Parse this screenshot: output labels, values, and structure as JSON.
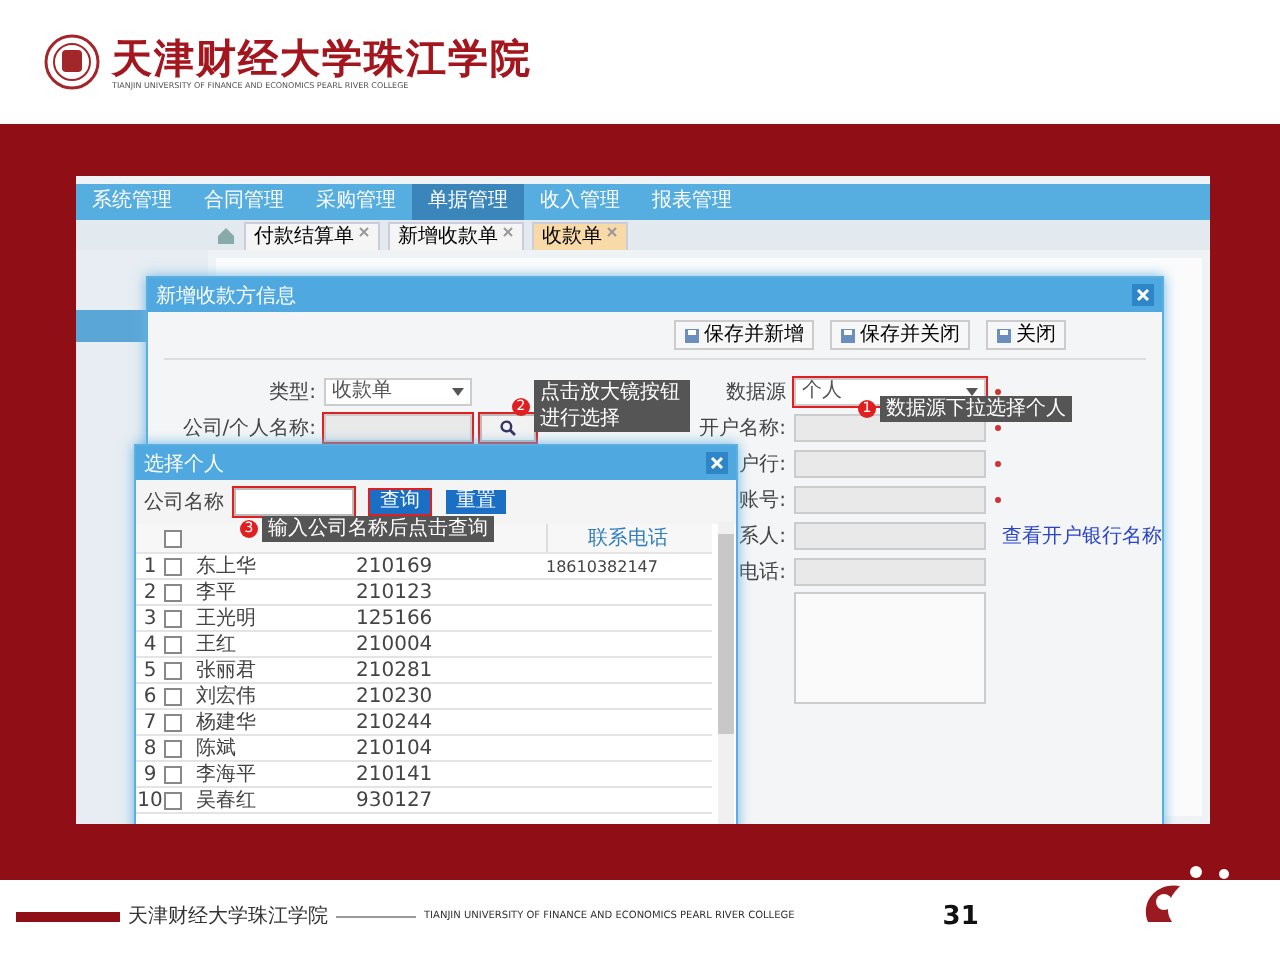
{
  "header": {
    "school_name": "天津财经大学珠江学院",
    "school_name_en": "TIANJIN UNIVERSITY OF FINANCE AND ECONOMICS PEARL RIVER COLLEGE"
  },
  "app": {
    "nav": [
      {
        "label": "系统管理",
        "selected": false
      },
      {
        "label": "合同管理",
        "selected": false
      },
      {
        "label": "采购管理",
        "selected": false
      },
      {
        "label": "单据管理",
        "selected": true
      },
      {
        "label": "收入管理",
        "selected": false
      },
      {
        "label": "报表管理",
        "selected": false
      }
    ],
    "tabs": [
      {
        "label": "付款结算单",
        "selected": false
      },
      {
        "label": "新增收款单",
        "selected": false
      },
      {
        "label": "收款单",
        "selected": true
      }
    ]
  },
  "main_dialog": {
    "title": "新增收款方信息",
    "buttons": [
      "保存并新增",
      "保存并关闭",
      "关闭"
    ],
    "left_fields": [
      {
        "label": "类型:",
        "kind": "select",
        "value": "收款单",
        "highlighted": false
      },
      {
        "label": "公司/个人名称:",
        "kind": "lookup",
        "highlighted": true
      }
    ],
    "right_fields": [
      {
        "label": "数据源",
        "kind": "select",
        "value": "个人",
        "highlighted": true,
        "required": true
      },
      {
        "label": "开户名称:",
        "kind": "text",
        "highlighted": false,
        "required": true
      },
      {
        "label": "户行:",
        "kind": "text",
        "highlighted": false,
        "required": true
      },
      {
        "label": "账号:",
        "kind": "text",
        "highlighted": false,
        "required": true
      },
      {
        "label": "系人:",
        "kind": "text",
        "highlighted": false,
        "required": false,
        "link": "查看开户银行名称"
      },
      {
        "label": "电话:",
        "kind": "text",
        "highlighted": false,
        "required": false
      },
      {
        "kind": "textarea",
        "highlighted": false,
        "required": false
      }
    ]
  },
  "select_dialog": {
    "title": "选择个人",
    "search_label": "公司名称",
    "search_highlighted": true,
    "buttons": [
      {
        "label": "查询",
        "highlighted": true
      },
      {
        "label": "重置",
        "highlighted": false
      }
    ],
    "phone_header": "联系电话",
    "all_checked": false,
    "rows": [
      {
        "index": "1",
        "checked": false,
        "name": "东上华",
        "code": "210169",
        "phone": "18610382147"
      },
      {
        "index": "2",
        "checked": false,
        "name": "李平",
        "code": "210123"
      },
      {
        "index": "3",
        "checked": false,
        "name": "王光明",
        "code": "125166"
      },
      {
        "index": "4",
        "checked": false,
        "name": "王红",
        "code": "210004"
      },
      {
        "index": "5",
        "checked": false,
        "name": "张丽君",
        "code": "210281"
      },
      {
        "index": "6",
        "checked": false,
        "name": "刘宏伟",
        "code": "210230"
      },
      {
        "index": "7",
        "checked": false,
        "name": "杨建华",
        "code": "210244"
      },
      {
        "index": "8",
        "checked": false,
        "name": "陈斌",
        "code": "210104"
      },
      {
        "index": "9",
        "checked": false,
        "name": "李海平",
        "code": "210141"
      },
      {
        "index": "10",
        "checked": false,
        "name": "吴春红",
        "code": "930127"
      }
    ]
  },
  "callouts": [
    {
      "number": "2",
      "text": "点击放大镜按钮进行选择"
    },
    {
      "number": "1",
      "text": "数据源下拉选择个人"
    },
    {
      "number": "3",
      "text": "输入公司名称后点击查询"
    }
  ],
  "footer": {
    "school_name": "天津财经大学珠江学院",
    "school_name_en": "TIANJIN UNIVERSITY OF FINANCE AND ECONOMICS PEARL RIVER COLLEGE",
    "page": "31"
  }
}
